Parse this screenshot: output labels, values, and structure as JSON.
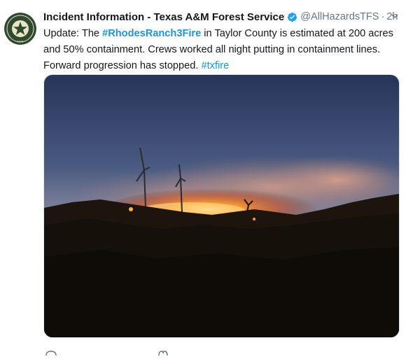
{
  "tweet": {
    "author_name": "Incident Information - Texas A&M Forest Service",
    "handle": "@AllHazardsTFS",
    "separator": "·",
    "time": "2h",
    "text": {
      "p1": "Update: The ",
      "hashtag_fire": "#RhodesRanch3Fire",
      "p2": " in Taylor County is estimated at 200 acres and 50% containment. Crews worked all night putting in containment lines. Forward progression has stopped. ",
      "hashtag_tx": "#txfire"
    }
  },
  "avatar": {
    "icon": "texas-am-forest-service-seal",
    "seal_year": "1915"
  },
  "icons": {
    "verified": "verified-badge-icon",
    "caret": "chevron-down-icon",
    "reply": "reply-icon",
    "like": "heart-icon"
  },
  "colors": {
    "text": "#14171a",
    "secondary": "#657786",
    "link": "#1b95e0",
    "verified": "#1da1f2",
    "seal": "#2f4a2e"
  }
}
